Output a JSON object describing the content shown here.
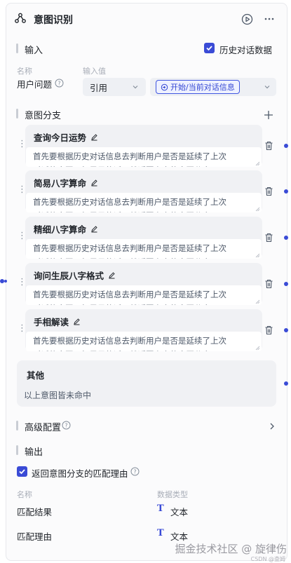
{
  "node": {
    "title": "意图识别"
  },
  "input": {
    "section_title": "输入",
    "history_label": "历史对话数据",
    "history_checked": true,
    "col_name": "名称",
    "col_value": "输入值",
    "param_name": "用户问题",
    "ref_select": "引用",
    "ref_tag": "开始/当前对话信息"
  },
  "branches": {
    "section_title": "意图分支",
    "items": [
      {
        "title": "查询今日运势",
        "line1": "首先要根据历史对话信息去判断用户是否是延续了上次",
        "line2": "对话的意图，如果是的话，就返回上次的意图分支"
      },
      {
        "title": "简易八字算命",
        "line1": "首先要根据历史对话信息去判断用户是否是延续了上次",
        "line2": "对话的意图，如果是的话，就返回上次的意图分支"
      },
      {
        "title": "精细八字算命",
        "line1": "首先要根据历史对话信息去判断用户是否是延续了上次",
        "line2": "对话的意图，如果是的话，就返回上次的意图分支"
      },
      {
        "title": "询问生辰八字格式",
        "line1": "首先要根据历史对话信息去判断用户是否是延续了上次",
        "line2": "对话的意图，如果是的话，就返回上次的意图分支"
      },
      {
        "title": "手相解读",
        "line1": "首先要根据历史对话信息去判断用户是否是延续了上次",
        "line2": "对话的意图，如果是的话，就返回上次的意图分支"
      }
    ],
    "other_title": "其他",
    "other_desc": "以上意图皆未命中"
  },
  "advanced": {
    "title": "高级配置"
  },
  "output": {
    "section_title": "输出",
    "reason_label": "返回意图分支的匹配理由",
    "reason_checked": true,
    "col_name": "名称",
    "col_type": "数据类型",
    "rows": [
      {
        "name": "匹配结果",
        "type": "文本"
      },
      {
        "name": "匹配理由",
        "type": "文本"
      }
    ]
  },
  "watermark": {
    "text": "掘金技术社区 @ 旋律伤",
    "sub": "CSDN @查姆"
  },
  "colors": {
    "accent": "#3a4bd6",
    "card": "#f0f1f4",
    "panel": "#fbfbfc"
  }
}
